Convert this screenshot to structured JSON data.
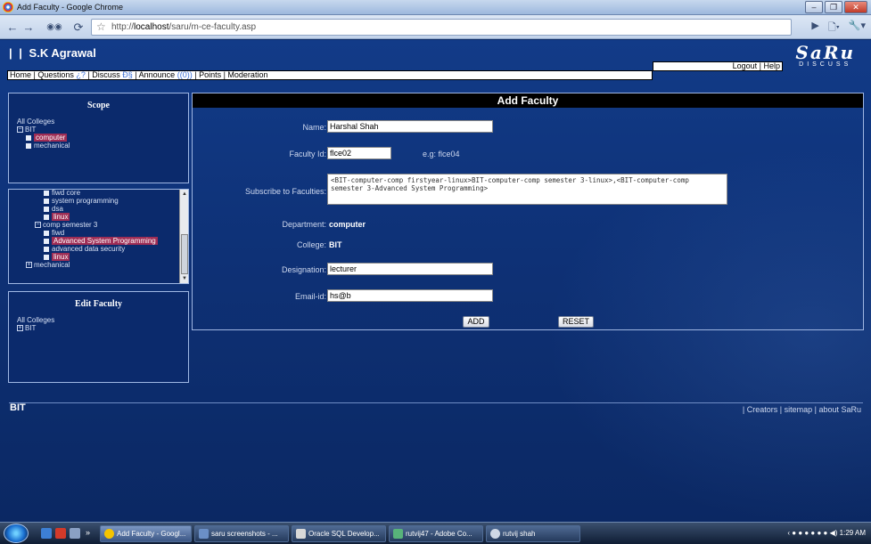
{
  "window": {
    "title": "Add Faculty - Google Chrome"
  },
  "browser": {
    "url_prefix": "http://",
    "url_host": "localhost",
    "url_path": "/saru/m-ce-faculty.asp"
  },
  "header": {
    "user": "S.K Agrawal",
    "logo_big": "SaRu",
    "logo_small": "DISCUSS",
    "logout": "Logout",
    "help": "Help"
  },
  "menu": {
    "home": "Home",
    "questions": "Questions",
    "questions_badge": "¿?",
    "discuss": "Discuss",
    "discuss_badge": "Ð§",
    "announce": "Announce",
    "announce_badge": "((0))",
    "points": "Points",
    "moderation": "Moderation"
  },
  "scope": {
    "title": "Scope",
    "all": "All Colleges",
    "college": "BIT",
    "items": [
      "computer",
      "mechanical"
    ],
    "selected": "computer"
  },
  "tree2": {
    "items": [
      "fiwd core",
      "system programming",
      "dsa",
      "linux"
    ],
    "group": "comp semester 3",
    "group_items": [
      "fiwd",
      "Advanced System Programming",
      "advanced data security",
      "linux"
    ],
    "bottom": "mechanical"
  },
  "edit_faculty": {
    "title": "Edit Faculty",
    "all": "All Colleges",
    "college": "BIT"
  },
  "form": {
    "heading": "Add Faculty",
    "name_label": "Name:",
    "name_value": "Harshal Shah",
    "fid_label": "Faculty Id:",
    "fid_value": "flce02",
    "fid_hint": "e.g: flce04",
    "subscribe_label": "Subscribe to Faculties:",
    "subscribe_value": "<BIT-computer-comp firstyear-linux>BIT-computer-comp semester 3-linux>,<BIT-computer-comp semester 3-Advanced System Programming>",
    "dept_label": "Department:",
    "dept_value": "computer",
    "college_label": "College:",
    "college_value": "BIT",
    "desig_label": "Designation:",
    "desig_value": "lecturer",
    "email_label": "Email-id:",
    "email_value": "hs@b",
    "add_button": "ADD",
    "reset_button": "RESET"
  },
  "footer": {
    "left": "BIT",
    "creators": "Creators",
    "sitemap": "sitemap",
    "about": "about SaRu"
  },
  "taskbar": {
    "items": [
      "Add Faculty - Googl...",
      "saru screenshots - ...",
      "Oracle SQL Develop...",
      "rutvij47 - Adobe Co...",
      "rutvij shah"
    ],
    "time": "1:29 AM"
  }
}
